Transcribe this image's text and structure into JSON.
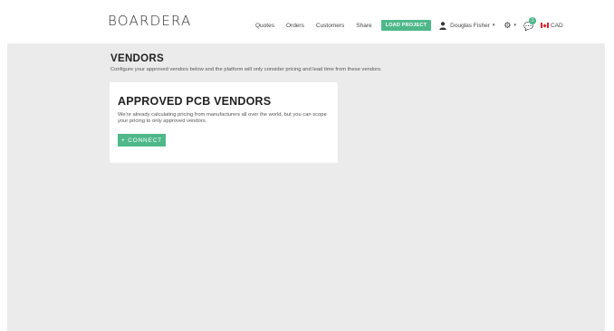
{
  "brand": {
    "logo_text": "BOARDERA"
  },
  "nav": {
    "links": [
      "Quotes",
      "Orders",
      "Customers",
      "Share"
    ],
    "load_project_label": "LOAD PROJECT",
    "user_name": "Douglas Fisher",
    "notification_count": "1",
    "currency": "CAD"
  },
  "page": {
    "title": "VENDORS",
    "subtitle": "Configure your approved vendors below and the platform will only consider pricing and lead time from these vendors."
  },
  "card": {
    "title": "APPROVED PCB VENDORS",
    "description": "We're already calculating pricing from manufacturers all over the world, but you can scope your pricing to only approved vendors.",
    "connect_label": "+ CONNECT"
  },
  "colors": {
    "accent": "#4fb88a",
    "content_background": "#ebebeb",
    "card_background": "#ffffff"
  },
  "icons": [
    "user-icon",
    "caret-down-icon",
    "gear-icon",
    "chat-icon",
    "canada-flag-icon"
  ]
}
